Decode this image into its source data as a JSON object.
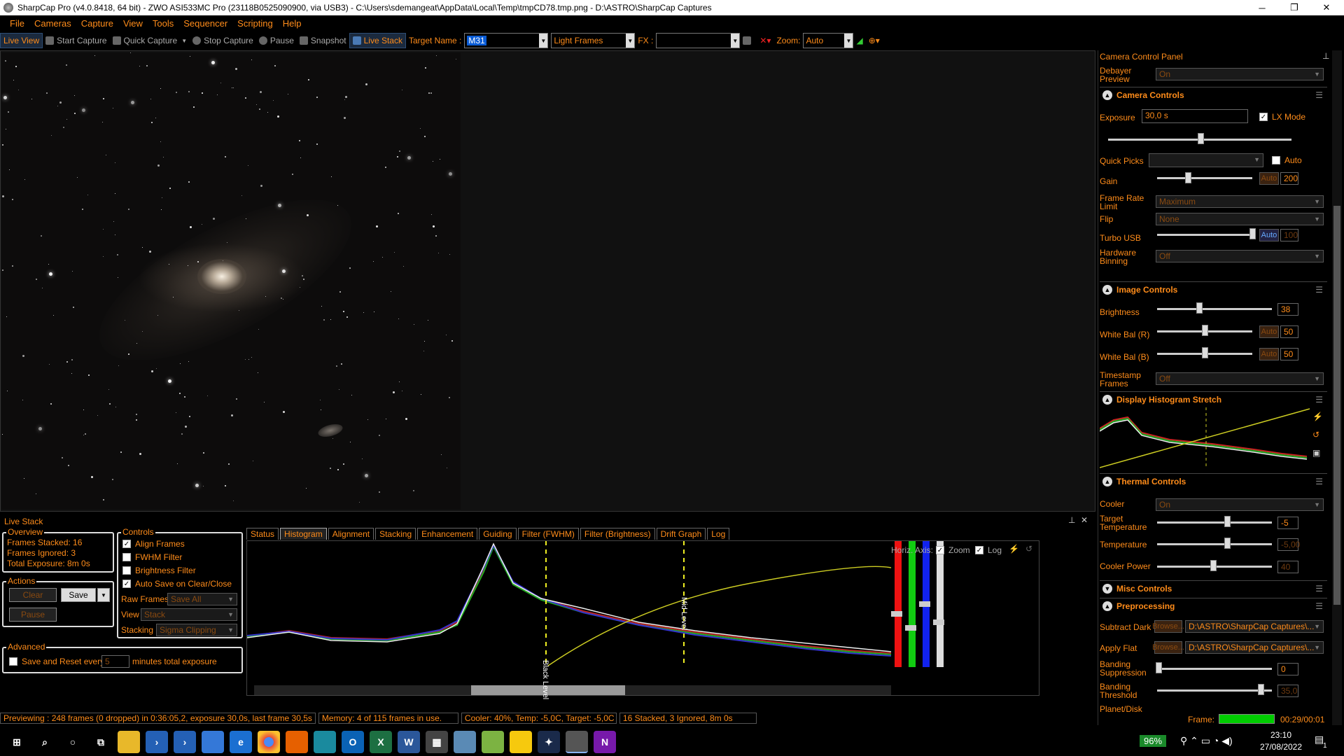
{
  "window": {
    "title": "SharpCap Pro (v4.0.8418, 64 bit) - ZWO ASI533MC Pro (23118B0525090900, via USB3) - C:\\Users\\sdemangeat\\AppData\\Local\\Temp\\tmpCD78.tmp.png - D:\\ASTRO\\SharpCap Captures",
    "minimize": "─",
    "maximize": "❐",
    "close": "✕"
  },
  "menu": [
    "File",
    "Cameras",
    "Capture",
    "View",
    "Tools",
    "Sequencer",
    "Scripting",
    "Help"
  ],
  "toolbar": {
    "live_view": "Live View",
    "start_capture": "Start Capture",
    "quick_capture": "Quick Capture",
    "stop_capture": "Stop Capture",
    "pause": "Pause",
    "snapshot": "Snapshot",
    "live_stack": "Live Stack",
    "target_label": "Target Name :",
    "target_value": "M31",
    "frame_type": "Light Frames",
    "fx_label": "FX :",
    "fx_value": "",
    "zoom_label": "Zoom:",
    "zoom_value": "Auto"
  },
  "live_stack": {
    "title": "Live Stack",
    "overview": {
      "label": "Overview",
      "frames_stacked": "Frames Stacked:  16",
      "frames_ignored": "Frames Ignored:   3",
      "total_exposure": "Total Exposure:   8m 0s"
    },
    "actions": {
      "label": "Actions",
      "clear": "Clear",
      "save": "Save",
      "pause": "Pause"
    },
    "controls": {
      "label": "Controls",
      "align_frames": "Align Frames",
      "fwhm_filter": "FWHM Filter",
      "brightness_filter": "Brightness Filter",
      "auto_save": "Auto Save on Clear/Close",
      "raw_frames_label": "Raw Frames",
      "raw_frames_value": "Save All",
      "view_label": "View",
      "view_value": "Stack",
      "stacking_label": "Stacking",
      "stacking_value": "Sigma Clipping"
    },
    "advanced": {
      "label": "Advanced",
      "save_reset": "Save and Reset every",
      "minutes_value": "5",
      "minutes_suffix": "minutes total exposure"
    },
    "tabs": [
      "Status",
      "Histogram",
      "Alignment",
      "Stacking",
      "Enhancement",
      "Guiding",
      "Filter (FWHM)",
      "Filter (Brightness)",
      "Drift Graph",
      "Log"
    ],
    "active_tab": "Histogram",
    "histogram": {
      "horiz_axis": "Horiz. Axis:",
      "zoom": "Zoom",
      "log": "Log",
      "black_level": "Black Level",
      "mid_level": "Mid Level"
    }
  },
  "status": {
    "previewing": "Previewing : 248 frames (0 dropped) in 0:36:05,2, exposure 30,0s, last frame 30,5s",
    "memory": "Memory: 4 of 115 frames in use.",
    "cooler": "Cooler: 40%, Temp: -5,0C, Target: -5,0C",
    "stacked": "16 Stacked, 3 Ignored, 8m 0s",
    "frame_label": "Frame:",
    "frame_time": "00:29/00:01"
  },
  "panel": {
    "title": "Camera Control Panel",
    "debayer_label": "Debayer Preview",
    "debayer_value": "On",
    "camera_controls": "Camera Controls",
    "exposure_label": "Exposure",
    "exposure_value": "30,0 s",
    "lx_mode": "LX Mode",
    "quick_picks": "Quick Picks",
    "auto": "Auto",
    "gain_label": "Gain",
    "gain_value": "200",
    "frame_rate_label": "Frame Rate Limit",
    "frame_rate_value": "Maximum",
    "flip_label": "Flip",
    "flip_value": "None",
    "turbo_label": "Turbo USB",
    "turbo_value": "100",
    "binning_label": "Hardware Binning",
    "binning_value": "Off",
    "image_controls": "Image Controls",
    "brightness_label": "Brightness",
    "brightness_value": "38",
    "wb_r_label": "White Bal (R)",
    "wb_r_value": "50",
    "wb_b_label": "White Bal (B)",
    "wb_b_value": "50",
    "timestamp_label": "Timestamp Frames",
    "timestamp_value": "Off",
    "display_stretch": "Display Histogram Stretch",
    "thermal_controls": "Thermal Controls",
    "cooler_label": "Cooler",
    "cooler_value": "On",
    "target_temp_label": "Target Temperature",
    "target_temp_value": "-5",
    "temperature_label": "Temperature",
    "temperature_value": "-5,00",
    "cooler_power_label": "Cooler Power",
    "cooler_power_value": "40",
    "misc_controls": "Misc Controls",
    "preprocessing": "Preprocessing",
    "subtract_dark_label": "Subtract Dark",
    "apply_flat_label": "Apply Flat",
    "browse": "Browse...",
    "dark_path": "D:\\ASTRO\\SharpCap Captures\\...",
    "flat_path": "D:\\ASTRO\\SharpCap Captures\\...",
    "banding_supp_label": "Banding Suppression",
    "banding_supp_value": "0",
    "banding_thresh_label": "Banding Threshold",
    "banding_thresh_value": "35,0",
    "planet_disk_label": "Planet/Disk"
  },
  "taskbar": {
    "battery": "96%",
    "time": "23:10",
    "date": "27/08/2022",
    "notifications": "1"
  },
  "colors": {
    "accent": "#ff8c1a",
    "background": "#000000",
    "active_tab_bg": "#1b2a3e"
  }
}
